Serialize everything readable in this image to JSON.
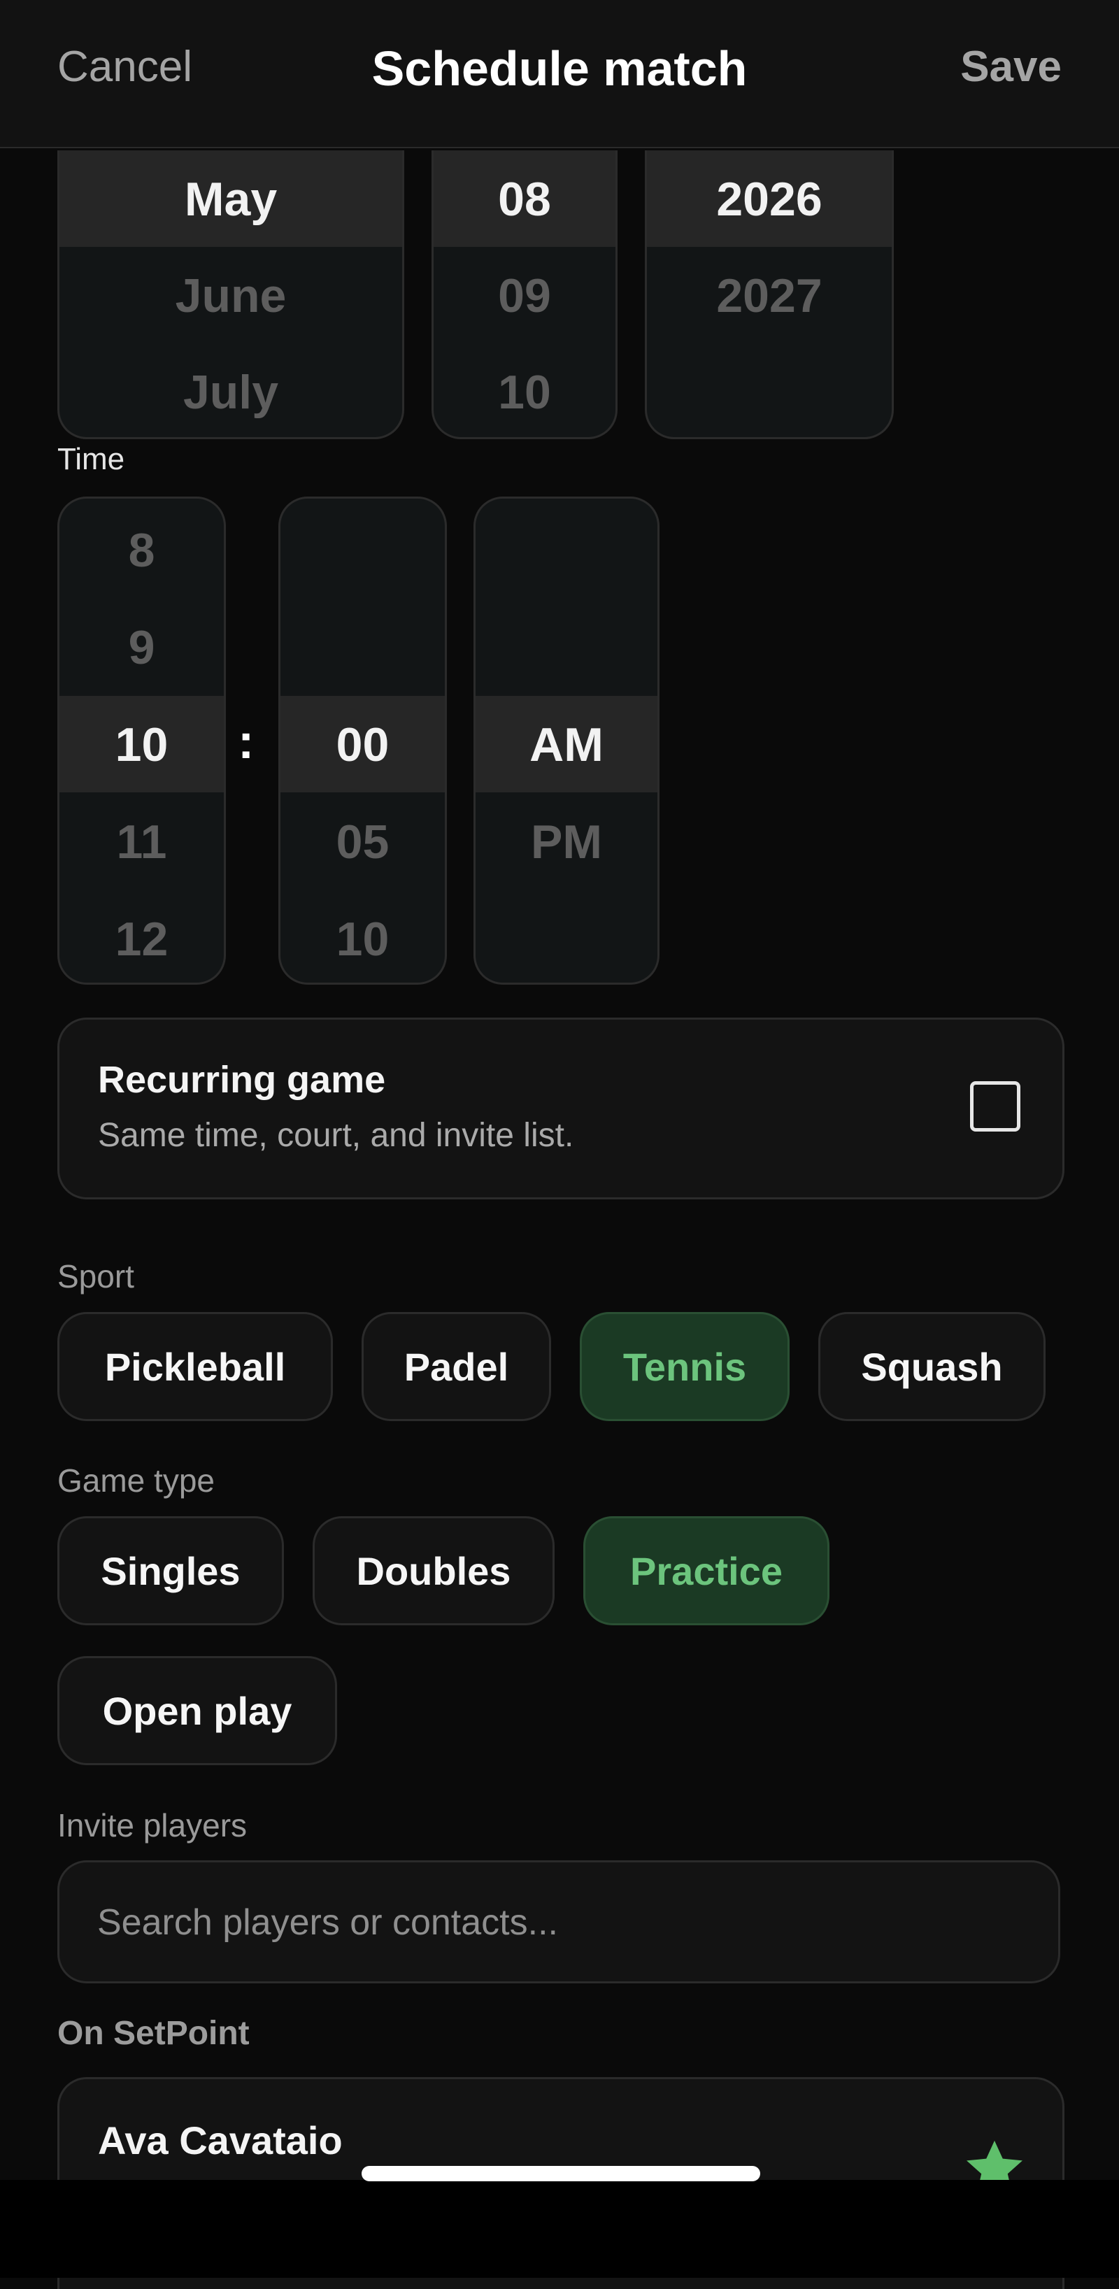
{
  "header": {
    "cancel": "Cancel",
    "title": "Schedule match",
    "save": "Save"
  },
  "date": {
    "month": {
      "options": [
        "May",
        "June",
        "July"
      ],
      "selected": "May"
    },
    "day": {
      "options": [
        "08",
        "09",
        "10"
      ],
      "selected": "08"
    },
    "year": {
      "options": [
        "2026",
        "2027"
      ],
      "selected": "2026"
    }
  },
  "time": {
    "label": "Time",
    "hour": {
      "options": [
        "8",
        "9",
        "10",
        "11",
        "12"
      ],
      "selected": "10"
    },
    "separator": ":",
    "minute": {
      "options": [
        "00",
        "05",
        "10"
      ],
      "selected": "00"
    },
    "ampm": {
      "options": [
        "AM",
        "PM"
      ],
      "selected": "AM"
    }
  },
  "recurring": {
    "title": "Recurring game",
    "subtitle": "Same time, court, and invite list.",
    "checked": false
  },
  "sport": {
    "label": "Sport",
    "options": [
      "Pickleball",
      "Padel",
      "Tennis",
      "Squash"
    ],
    "selected": "Tennis"
  },
  "game_type": {
    "label": "Game type",
    "options": [
      "Singles",
      "Doubles",
      "Practice",
      "Open play"
    ],
    "selected": "Practice"
  },
  "invite": {
    "label": "Invite players",
    "search_placeholder": "Search players or contacts...",
    "search_value": ""
  },
  "on_setpoint": {
    "label": "On SetPoint",
    "players": [
      {
        "name": "Ava Cavataio",
        "favorite": true
      }
    ]
  },
  "colors": {
    "accent": "#6cc47d",
    "accent_bg": "#1b3a24",
    "background": "#0a0a0a"
  }
}
